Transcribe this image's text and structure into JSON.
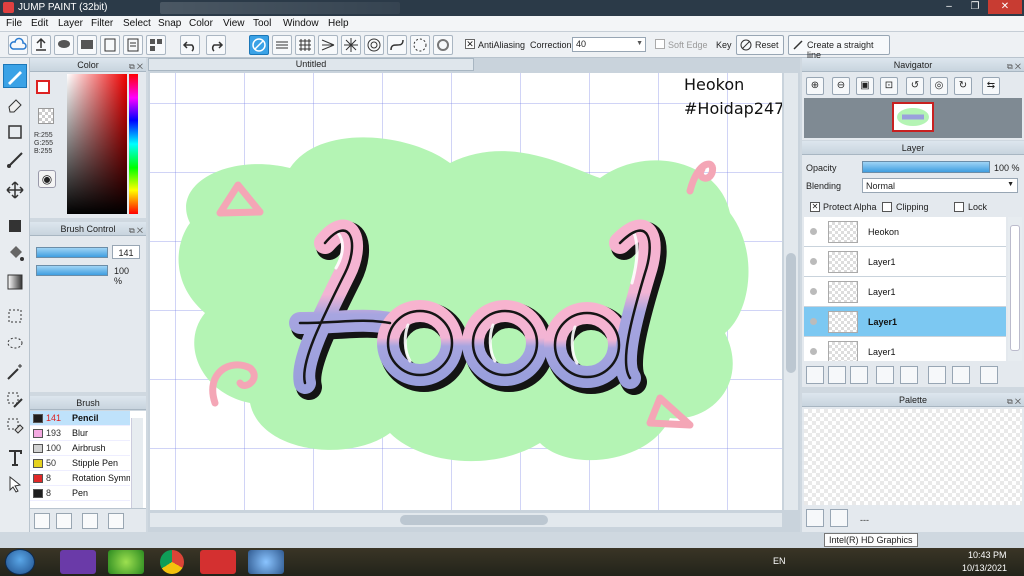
{
  "window": {
    "title": "JUMP PAINT (32bit)",
    "min": "–",
    "max": "❐",
    "close": "✕"
  },
  "menu": [
    "File",
    "Edit",
    "Layer",
    "Filter",
    "Select",
    "Snap",
    "Color",
    "View",
    "Tool",
    "Window",
    "Help"
  ],
  "toolbar": {
    "antialiasing_label": "AntiAliasing",
    "correction_label": "Correction",
    "correction_value": "40",
    "soft_edge_label": "Soft Edge",
    "key_label": "Key",
    "reset_label": "Reset",
    "straight_line_label": "Create a straight line"
  },
  "color_panel": {
    "title": "Color",
    "r": "R:255",
    "g": "G:255",
    "b": "B:255"
  },
  "brush_control": {
    "title": "Brush Control",
    "size": "141",
    "opacity": "100 %"
  },
  "brush_panel": {
    "title": "Brush",
    "items": [
      {
        "size": "141",
        "name": "Pencil",
        "color": "#1e1e1e",
        "selected": true
      },
      {
        "size": "193",
        "name": "Blur",
        "color": "#f4a9e0",
        "selected": false
      },
      {
        "size": "100",
        "name": "Airbrush",
        "color": "#d2d2d2",
        "selected": false
      },
      {
        "size": "50",
        "name": "Stipple Pen",
        "color": "#e6d21e",
        "selected": false
      },
      {
        "size": "8",
        "name": "Rotation Symm",
        "color": "#e02828",
        "selected": false
      },
      {
        "size": "8",
        "name": "Pen",
        "color": "#1e1e1e",
        "selected": false
      }
    ]
  },
  "canvas": {
    "tab": "Untitled",
    "text_line1": "Heokon",
    "text_line2": "#Hoidap247",
    "artwork_word": "Food"
  },
  "navigator": {
    "title": "Navigator"
  },
  "layer_panel": {
    "title": "Layer",
    "opacity_label": "Opacity",
    "opacity_value": "100 %",
    "blending_label": "Blending",
    "blending_value": "Normal",
    "protect_alpha_label": "Protect Alpha",
    "clipping_label": "Clipping",
    "lock_label": "Lock",
    "layers": [
      {
        "name": "Heokon",
        "selected": false
      },
      {
        "name": "Layer1",
        "selected": false
      },
      {
        "name": "Layer1",
        "selected": false
      },
      {
        "name": "Layer1",
        "selected": true
      },
      {
        "name": "Layer1",
        "selected": false
      }
    ]
  },
  "palette_panel": {
    "title": "Palette",
    "dash": "---"
  },
  "tooltip": "Intel(R) HD Graphics",
  "taskbar": {
    "language": "EN",
    "time": "10:43 PM",
    "date": "10/13/2021"
  },
  "colors": {
    "accent": "#3aa2e6",
    "blob": "#b4f4b4",
    "pink": "#f9b4cc",
    "purple": "#9aa0dc"
  }
}
